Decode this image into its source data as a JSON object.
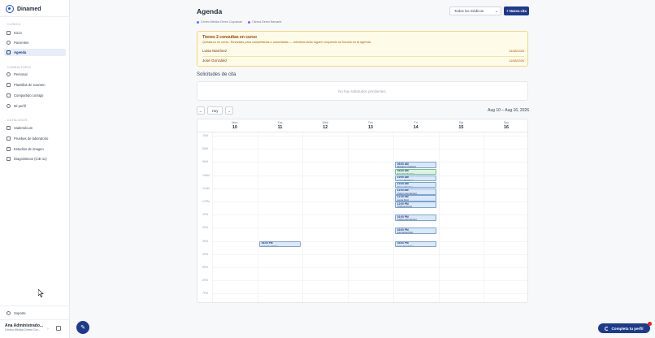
{
  "app": {
    "name": "Dinamed"
  },
  "sidebar": {
    "sections": [
      {
        "title": "CLÍNICA",
        "items": [
          {
            "label": "Inicio",
            "icon": "home-icon",
            "active": false
          },
          {
            "label": "Pacientes",
            "icon": "users-icon",
            "active": false
          },
          {
            "label": "Agenda",
            "icon": "calendar-icon",
            "active": true
          }
        ]
      },
      {
        "title": "CONSULTORIO",
        "items": [
          {
            "label": "Personal",
            "icon": "person-icon",
            "active": false
          },
          {
            "label": "Plantillas de examen",
            "icon": "template-icon",
            "active": false
          },
          {
            "label": "Compartido contigo",
            "icon": "share-icon",
            "active": false
          },
          {
            "label": "Mi perfil",
            "icon": "profile-icon",
            "active": false
          }
        ]
      },
      {
        "title": "CATÁLOGOS",
        "items": [
          {
            "label": "Vademécum",
            "icon": "pill-icon",
            "active": false
          },
          {
            "label": "Pruebas de laboratorio",
            "icon": "flask-icon",
            "active": false
          },
          {
            "label": "Estudios de imagen",
            "icon": "image-icon",
            "active": false
          },
          {
            "label": "Diagnósticos (CIE-11)",
            "icon": "list-icon",
            "active": false
          }
        ]
      }
    ],
    "support_label": "Soporte",
    "user": {
      "name": "Ana Administrado...",
      "org": "Centro Médico Demo Cor..."
    }
  },
  "header": {
    "title": "Agenda",
    "doctor_select": "Todos los médicos",
    "new_button": "+ Nueva cita",
    "legend": [
      {
        "label": "Centro Médico Demo Coyoacán",
        "color": "#3b82f6"
      },
      {
        "label": "Clínica Demo Narvarte",
        "color": "#8b5cf6"
      }
    ]
  },
  "alert": {
    "title": "Tienes 2 consultas en curso",
    "description": "Quedaron en curso. Revísalas para completarlas o cancelarlas — mientras tanto siguen ocupando su horario en la agenda.",
    "rows": [
      {
        "name": "Luisa Martínez",
        "date": "14/08/2026"
      },
      {
        "name": "José González",
        "date": "11/08/2026"
      }
    ],
    "colors": {
      "background": "#fefbe9",
      "border": "#f3d87a"
    }
  },
  "requests": {
    "title": "Solicitudes de cita",
    "empty": "No hay solicitudes pendientes."
  },
  "week_nav": {
    "prev": "←",
    "today": "Hoy",
    "next": "→",
    "range": "Aug 10 – Aug 16, 2026"
  },
  "calendar": {
    "days": [
      {
        "name": "Mon",
        "num": "10"
      },
      {
        "name": "Tue",
        "num": "11"
      },
      {
        "name": "Wed",
        "num": "12"
      },
      {
        "name": "Thu",
        "num": "13"
      },
      {
        "name": "Fri",
        "num": "14"
      },
      {
        "name": "Sat",
        "num": "15"
      },
      {
        "name": "Sun",
        "num": "16"
      }
    ],
    "hours": [
      "7AM",
      "8AM",
      "9AM",
      "10AM",
      "11AM",
      "12PM",
      "1PM",
      "2PM",
      "3PM",
      "4PM",
      "5PM",
      "6PM",
      "7PM"
    ],
    "events": [
      {
        "day": 4,
        "time": "09:00 AM",
        "name": "Mariana Ordóñez",
        "green": false
      },
      {
        "day": 4,
        "time": "09:30 AM",
        "name": "Sandra Morales",
        "green": true
      },
      {
        "day": 4,
        "time": "10:00 AM",
        "name": "Luisa Martínez",
        "green": false
      },
      {
        "day": 4,
        "time": "10:30 AM",
        "name": "Diego Morales",
        "green": false
      },
      {
        "day": 4,
        "time": "11:00 AM",
        "name": "Carlos Hernández",
        "green": false
      },
      {
        "day": 4,
        "time": "11:30 AM",
        "name": "Lucía Ruiz",
        "green": false
      },
      {
        "day": 4,
        "time": "12:00 PM",
        "name": "Andrea Pérez",
        "green": false
      },
      {
        "day": 4,
        "time": "01:00 PM",
        "name": "Carlos Hernández",
        "green": false
      },
      {
        "day": 4,
        "time": "02:00 PM",
        "name": "Fernanda Ruiz",
        "green": false
      },
      {
        "day": 4,
        "time": "03:00 PM",
        "name": "José González",
        "green": false
      },
      {
        "day": 1,
        "time": "03:00 PM",
        "name": "José González",
        "green": false
      }
    ]
  },
  "fab": {
    "icon": "edit-icon"
  },
  "complete_profile": {
    "label": "Completa tu perfil"
  }
}
